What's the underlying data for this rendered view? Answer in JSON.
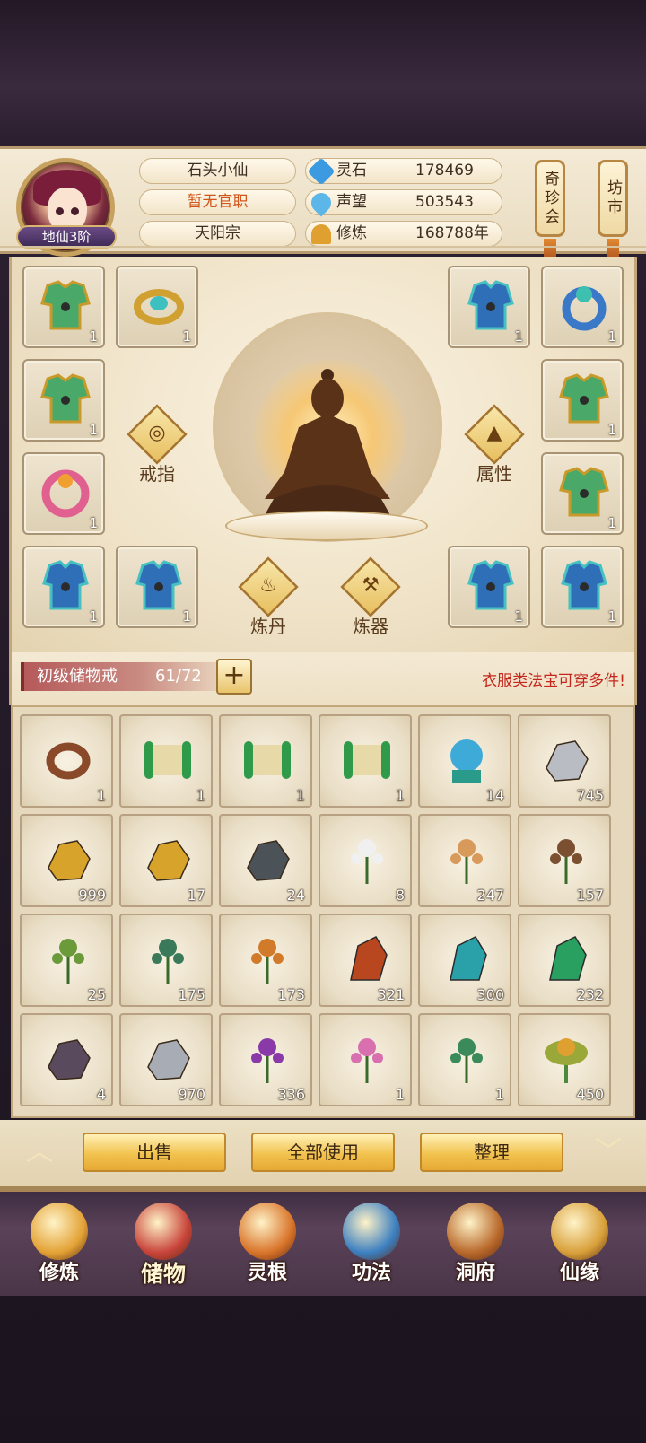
{
  "header": {
    "rank": "地仙3阶",
    "name": "石头小仙",
    "official_title": "暂无官职",
    "sect": "天阳宗",
    "resources": [
      {
        "label": "灵石",
        "value": "178469",
        "icon": "spirit-stone-icon",
        "color": "#3c9be0"
      },
      {
        "label": "声望",
        "value": "503543",
        "icon": "reputation-icon",
        "color": "#5db6e8"
      },
      {
        "label": "修炼",
        "value": "168788年",
        "icon": "meditation-icon",
        "color": "#e0a030"
      }
    ],
    "buttons": [
      {
        "label": "奇珍会"
      },
      {
        "label": "坊市"
      }
    ]
  },
  "equipment": {
    "left_slots": [
      {
        "name": "armor-green",
        "count": "1"
      },
      {
        "name": "ring-gold",
        "count": "1"
      },
      {
        "name": "armor-green",
        "count": "1"
      },
      {
        "name": "ring-pink",
        "count": "1"
      },
      {
        "name": "armor-blue-winged",
        "count": "1"
      },
      {
        "name": "armor-blue-winged",
        "count": "1"
      }
    ],
    "right_slots": [
      {
        "name": "armor-blue-winged",
        "count": "1"
      },
      {
        "name": "ring-blue",
        "count": "1"
      },
      {
        "name": "armor-green",
        "count": "1"
      },
      {
        "name": "armor-green",
        "count": "1"
      },
      {
        "name": "armor-blue-winged",
        "count": "1"
      },
      {
        "name": "armor-blue-winged",
        "count": "1"
      }
    ],
    "buttons": {
      "ring": "戒指",
      "attributes": "属性",
      "alchemy": "炼丹",
      "forge": "炼器"
    }
  },
  "storage": {
    "bag_name": "初级储物戒",
    "capacity": "61/72",
    "plus": "+",
    "notice": "衣服类法宝可穿多件!"
  },
  "inventory": [
    {
      "item": "ring-brown",
      "count": "1",
      "color": "#8a4a2a"
    },
    {
      "item": "scroll-green",
      "count": "1",
      "color": "#2f9a4a"
    },
    {
      "item": "scroll-green",
      "count": "1",
      "color": "#2f9a4a"
    },
    {
      "item": "scroll-green",
      "count": "1",
      "color": "#2f9a4a"
    },
    {
      "item": "crystal-orb",
      "count": "14",
      "color": "#3eaad8"
    },
    {
      "item": "silver-ore",
      "count": "745",
      "color": "#b9bcc2"
    },
    {
      "item": "gold-ore",
      "count": "999",
      "color": "#d7a32a"
    },
    {
      "item": "gold-ore",
      "count": "17",
      "color": "#d7a32a"
    },
    {
      "item": "dark-ore",
      "count": "24",
      "color": "#4b5258"
    },
    {
      "item": "white-flower",
      "count": "8",
      "color": "#f0f0f0"
    },
    {
      "item": "ginseng",
      "count": "247",
      "color": "#d89a5a"
    },
    {
      "item": "root-herb",
      "count": "157",
      "color": "#7a5030"
    },
    {
      "item": "green-herb",
      "count": "25",
      "color": "#6a9a3a"
    },
    {
      "item": "berry-branch",
      "count": "175",
      "color": "#3a7a5a"
    },
    {
      "item": "cordyceps",
      "count": "173",
      "color": "#d07a2a"
    },
    {
      "item": "red-crystal",
      "count": "321",
      "color": "#b8461e"
    },
    {
      "item": "teal-crystal",
      "count": "300",
      "color": "#2aa0a8"
    },
    {
      "item": "green-crystal",
      "count": "232",
      "color": "#2aa060"
    },
    {
      "item": "purple-stone",
      "count": "4",
      "color": "#5a4a5e"
    },
    {
      "item": "silver-stone",
      "count": "970",
      "color": "#a8acb4"
    },
    {
      "item": "purple-berries",
      "count": "336",
      "color": "#8a3aa8"
    },
    {
      "item": "pink-flowers",
      "count": "1",
      "color": "#d870b0"
    },
    {
      "item": "fern-herb",
      "count": "1",
      "color": "#3a8a5a"
    },
    {
      "item": "lotus-pod",
      "count": "450",
      "color": "#e0a030"
    }
  ],
  "actions": {
    "sell": "出售",
    "use_all": "全部使用",
    "sort": "整理"
  },
  "nav": [
    {
      "label": "修炼",
      "icon": "cultivation-icon",
      "color": "#e3a235"
    },
    {
      "label": "储物",
      "icon": "storage-bag-icon",
      "color": "#c8443a"
    },
    {
      "label": "灵根",
      "icon": "spirit-root-icon",
      "color": "#d9742a"
    },
    {
      "label": "功法",
      "icon": "technique-book-icon",
      "color": "#3c7fc0"
    },
    {
      "label": "洞府",
      "icon": "cave-palace-icon",
      "color": "#b8682a"
    },
    {
      "label": "仙缘",
      "icon": "immortal-fate-icon",
      "color": "#d8a03a"
    }
  ]
}
